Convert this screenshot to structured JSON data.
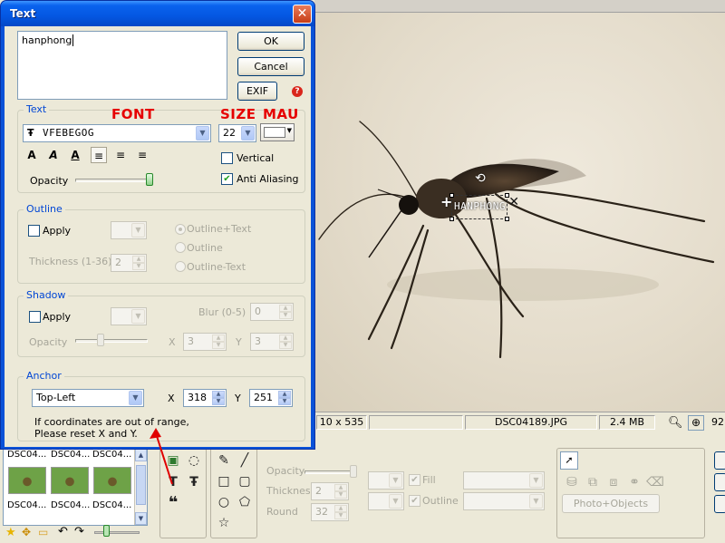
{
  "dialog": {
    "title": "Text",
    "close_glyph": "✕",
    "text_value": "hanphong",
    "buttons": {
      "ok": "OK",
      "cancel": "Cancel",
      "exif": "EXIF"
    },
    "help_icon": "?",
    "annotations": {
      "font": "FONT",
      "size": "SIZE",
      "color": "MAU"
    },
    "text_group": {
      "title": "Text",
      "font_value": "VFEBEGOG",
      "font_icon": "Ŧ",
      "size_value": "22",
      "color_value": "#ffffff",
      "format_buttons": [
        "A",
        "A",
        "A"
      ],
      "align_buttons": [
        "≡",
        "≡",
        "≡"
      ],
      "vertical_label": "Vertical",
      "vertical_checked": false,
      "anti_aliasing_label": "Anti Aliasing",
      "anti_aliasing_checked": true,
      "opacity_label": "Opacity",
      "opacity_level": 1.0
    },
    "outline_group": {
      "title": "Outline",
      "apply_label": "Apply",
      "thickness_label": "Thickness (1-36)",
      "thickness_value": "2",
      "radio_options": [
        "Outline+Text",
        "Outline",
        "Outline-Text"
      ],
      "radio_selected": 0
    },
    "shadow_group": {
      "title": "Shadow",
      "apply_label": "Apply",
      "blur_label": "Blur (0-5)",
      "blur_value": "0",
      "opacity_label": "Opacity",
      "opacity_level": 0.35,
      "x_label": "X",
      "x_value": "3",
      "y_label": "Y",
      "y_value": "3"
    },
    "anchor_group": {
      "title": "Anchor",
      "anchor_value": "Top-Left",
      "x_label": "X",
      "x_value": "318",
      "y_label": "Y",
      "y_value": "251",
      "note_line1": "If coordinates are out of range,",
      "note_line2": "Please reset X and Y."
    }
  },
  "canvas": {
    "overlay_text": "HANPHONG"
  },
  "statusbar": {
    "dimensions": "10 x 535",
    "filename": "DSC04189.JPG",
    "filesize": "2.4 MB",
    "zoom": "92"
  },
  "thumbnails": {
    "labels_row1": [
      "DSC04...",
      "DSC04...",
      "DSC04..."
    ],
    "labels_row2": [
      "DSC04...",
      "DSC04...",
      "DSC04..."
    ]
  },
  "bottom_toolbar": {
    "opacity_label": "Opacity",
    "thickness_label": "Thickness",
    "thickness_value": "2",
    "round_label": "Round",
    "round_value": "32",
    "fill_label": "Fill",
    "outline_label": "Outline",
    "photo_objects_label": "Photo+Objects"
  }
}
